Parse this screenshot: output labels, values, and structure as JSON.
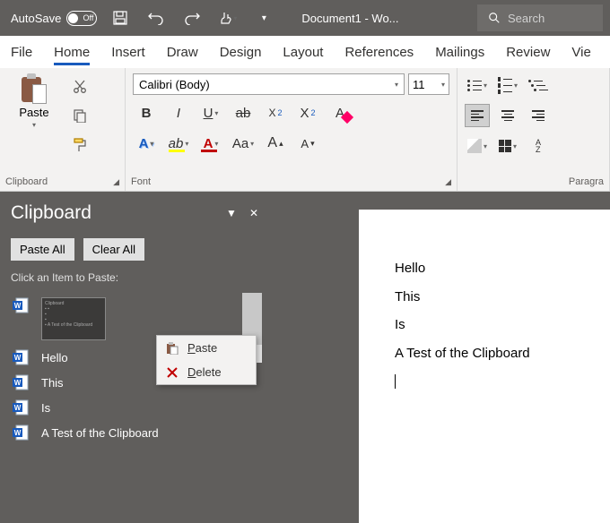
{
  "titlebar": {
    "autosave_label": "AutoSave",
    "autosave_state": "Off",
    "document_title": "Document1 - Wo...",
    "search_placeholder": "Search"
  },
  "tabs": [
    "File",
    "Home",
    "Insert",
    "Draw",
    "Design",
    "Layout",
    "References",
    "Mailings",
    "Review",
    "Vie"
  ],
  "active_tab": "Home",
  "ribbon": {
    "clipboard": {
      "paste": "Paste",
      "group_label": "Clipboard"
    },
    "font": {
      "name": "Calibri (Body)",
      "size": "11",
      "group_label": "Font"
    },
    "paragraph": {
      "group_label": "Paragra"
    },
    "sort_label": "A\nZ"
  },
  "clipboard_pane": {
    "title": "Clipboard",
    "paste_all": "Paste All",
    "clear_all": "Clear All",
    "hint": "Click an Item to Paste:",
    "items": [
      "Hello",
      "This",
      "Is",
      "A Test of the Clipboard"
    ],
    "context_menu": {
      "paste": "Paste",
      "delete": "Delete"
    }
  },
  "document_lines": [
    "Hello",
    "This",
    "Is",
    "A Test of the Clipboard"
  ]
}
